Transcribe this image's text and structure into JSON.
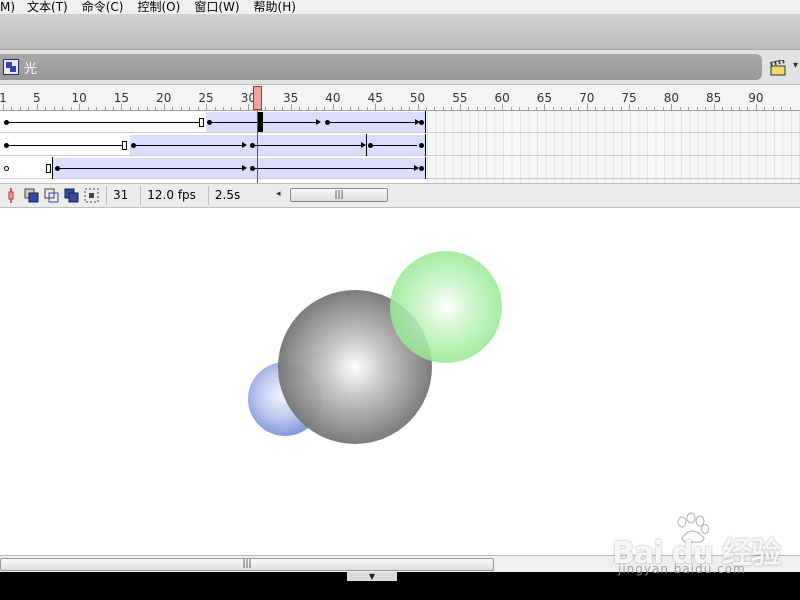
{
  "menu": {
    "items": [
      "M)",
      "文本(T)",
      "命令(C)",
      "控制(O)",
      "窗口(W)",
      "帮助(H)"
    ]
  },
  "scene": {
    "name": "光",
    "icon": "scene-icon",
    "edit_icon": "clapperboard-icon"
  },
  "timeline": {
    "ruler_labels": [
      "1",
      "5",
      "10",
      "15",
      "20",
      "25",
      "30",
      "35",
      "40",
      "45",
      "50",
      "55",
      "60",
      "65",
      "70",
      "75",
      "80",
      "85",
      "90"
    ],
    "current_frame": "31",
    "fps": "12.0 fps",
    "elapsed": "2.5s",
    "playhead_color": "#c03030",
    "tween_color": "#dcdcff"
  },
  "statusbar": {
    "icons": [
      "center-frame-icon",
      "onion-skin-icon",
      "onion-skin-outlines-icon",
      "edit-multiple-frames-icon",
      "modify-onion-markers-icon"
    ],
    "scroll_left": "◂",
    "scroll_grip": "|||"
  },
  "stage": {
    "objects": [
      {
        "name": "blue-sphere",
        "color": "#7f95d8"
      },
      {
        "name": "gray-sphere",
        "color": "#6a6a6a"
      },
      {
        "name": "green-sphere",
        "color": "#8ce88a"
      }
    ]
  },
  "bottom": {
    "scroll_grip": "|||",
    "collapse_arrow": "▼"
  },
  "watermark": {
    "brand": "Bai du 经验",
    "url": "jingyan.baidu.com"
  }
}
